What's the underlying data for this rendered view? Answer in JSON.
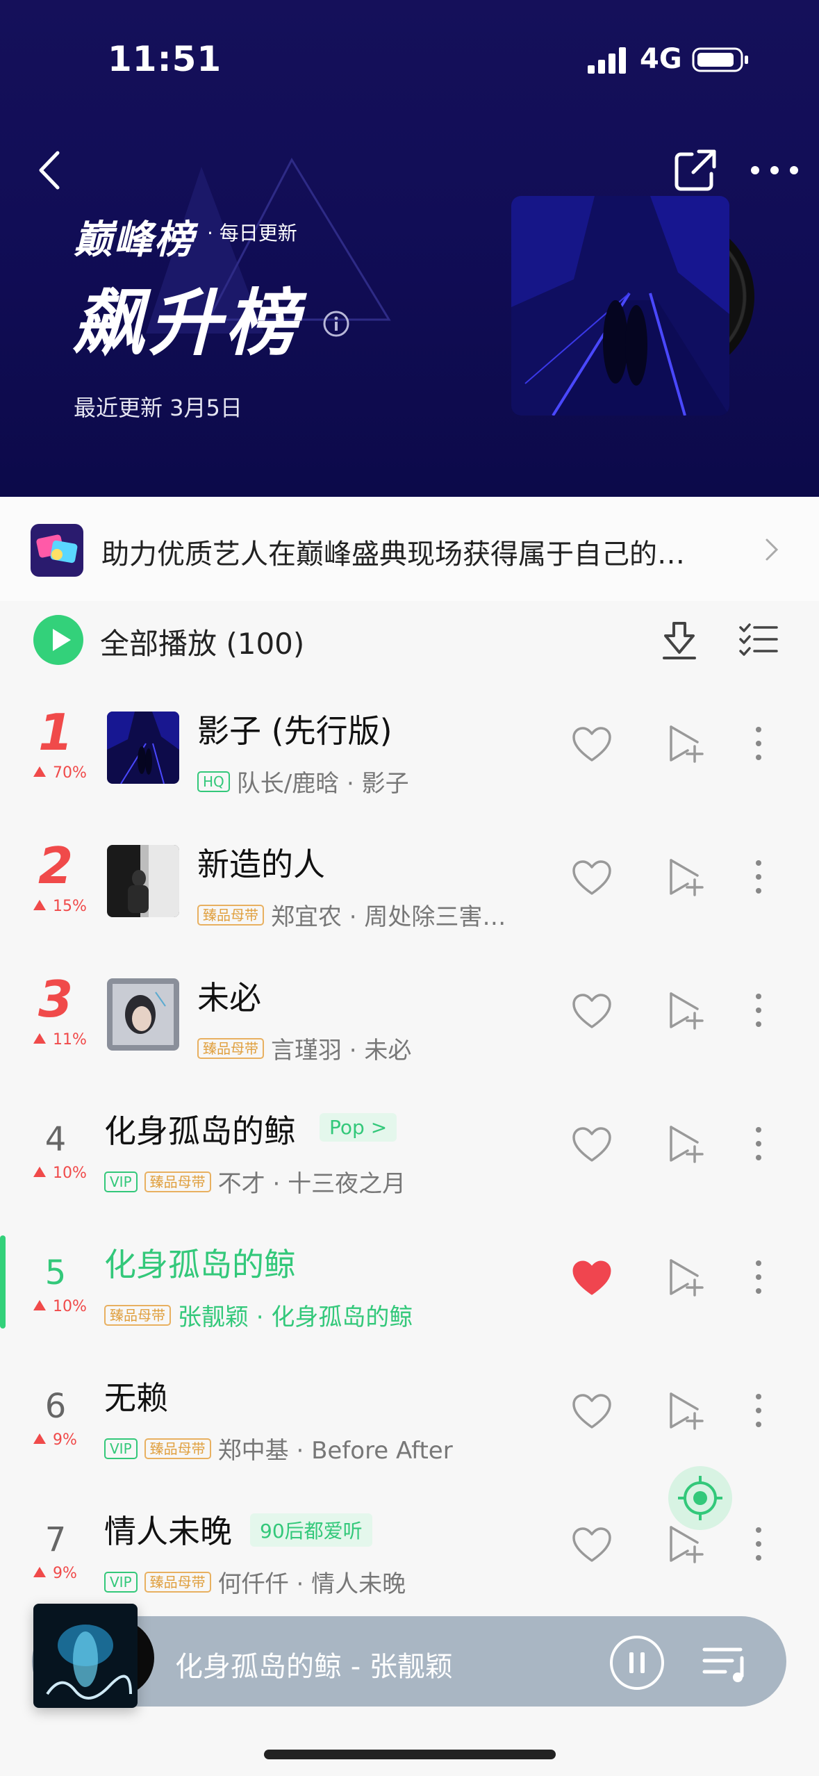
{
  "status_bar": {
    "time": "11:51",
    "network": "4G"
  },
  "header": {
    "brand": "巅峰榜",
    "brand_sub": "· 每日更新",
    "title": "飙升榜",
    "updated": "最近更新 3月5日"
  },
  "banner": {
    "text": "助力优质艺人在巅峰盛典现场获得属于自己的…"
  },
  "play_all": {
    "label": "全部播放 (100)"
  },
  "songs": [
    {
      "rank": "1",
      "delta": "70%",
      "title": "影子 (先行版)",
      "badges": [
        "HQ"
      ],
      "meta": "队长/鹿晗 · 影子",
      "genre": "",
      "liked": false
    },
    {
      "rank": "2",
      "delta": "15%",
      "title": "新造的人",
      "badges": [
        "臻品母带"
      ],
      "meta": "郑宜农 · 周处除三害…",
      "genre": "",
      "liked": false
    },
    {
      "rank": "3",
      "delta": "11%",
      "title": "未必",
      "badges": [
        "臻品母带"
      ],
      "meta": "言瑾羽 · 未必",
      "genre": "",
      "liked": false
    },
    {
      "rank": "4",
      "delta": "10%",
      "title": "化身孤岛的鲸",
      "badges": [
        "VIP",
        "臻品母带"
      ],
      "meta": "不才 · 十三夜之月",
      "genre": "Pop >",
      "liked": false
    },
    {
      "rank": "5",
      "delta": "10%",
      "title": "化身孤岛的鲸",
      "badges": [
        "臻品母带"
      ],
      "meta": "张靓颖 · 化身孤岛的鲸",
      "genre": "",
      "liked": true
    },
    {
      "rank": "6",
      "delta": "9%",
      "title": "无赖",
      "badges": [
        "VIP",
        "臻品母带"
      ],
      "meta": "郑中基 · Before After",
      "genre": "",
      "liked": false
    },
    {
      "rank": "7",
      "delta": "9%",
      "title": "情人未晚",
      "badges": [
        "VIP",
        "臻品母带"
      ],
      "meta": "何仟仟 · 情人未晚",
      "genre": "90后都爱听",
      "liked": false
    }
  ],
  "player": {
    "now_playing": "化身孤岛的鲸 - 张靓颖"
  },
  "colors": {
    "accent": "#33d17a",
    "rank_top": "#f04a4a",
    "header_bg": "#120e58",
    "gold_badge": "#e0a040"
  },
  "icons": [
    "back-arrow-icon",
    "share-icon",
    "more-icon",
    "info-icon",
    "play-icon",
    "download-icon",
    "multi-select-icon",
    "heart-icon",
    "add-to-playlist-icon",
    "more-vertical-icon",
    "pause-icon",
    "queue-icon",
    "chevron-right-icon"
  ]
}
